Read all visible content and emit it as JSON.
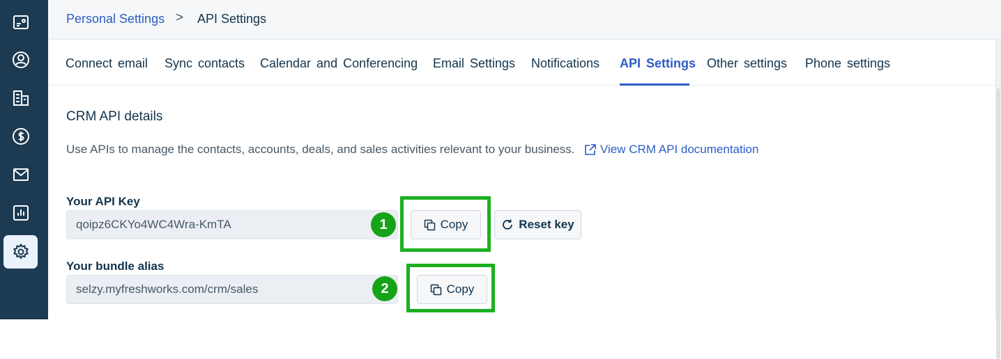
{
  "sidebar": {
    "items": [
      {
        "icon": "dashboard-icon"
      },
      {
        "icon": "contacts-icon"
      },
      {
        "icon": "accounts-icon"
      },
      {
        "icon": "deals-icon"
      },
      {
        "icon": "email-icon"
      },
      {
        "icon": "reports-icon"
      },
      {
        "icon": "settings-icon",
        "active": true
      }
    ]
  },
  "breadcrumb": {
    "parent": "Personal Settings",
    "separator": ">",
    "current": "API Settings"
  },
  "tabs": [
    {
      "label": "Connect email"
    },
    {
      "label": "Sync contacts"
    },
    {
      "label": "Calendar and Conferencing"
    },
    {
      "label": "Email Settings"
    },
    {
      "label": "Notifications"
    },
    {
      "label": "API Settings",
      "active": true
    },
    {
      "label": "Other settings"
    },
    {
      "label": "Phone settings"
    }
  ],
  "main": {
    "title": "CRM API details",
    "description": "Use APIs to manage the contacts, accounts, deals, and sales activities relevant to your business.",
    "doc_link": "View CRM API documentation",
    "api_key": {
      "label": "Your API Key",
      "value": "qoipz6CKYo4WC4Wra-KmTA",
      "copy_label": "Copy",
      "reset_label": "Reset key"
    },
    "bundle_alias": {
      "label": "Your bundle alias",
      "value": "selzy.myfreshworks.com/crm/sales",
      "copy_label": "Copy"
    }
  },
  "annotations": [
    {
      "number": "1"
    },
    {
      "number": "2"
    }
  ],
  "colors": {
    "sidebar_bg": "#1c3a52",
    "accent": "#2c5cc5",
    "highlight": "#1bb01f"
  }
}
